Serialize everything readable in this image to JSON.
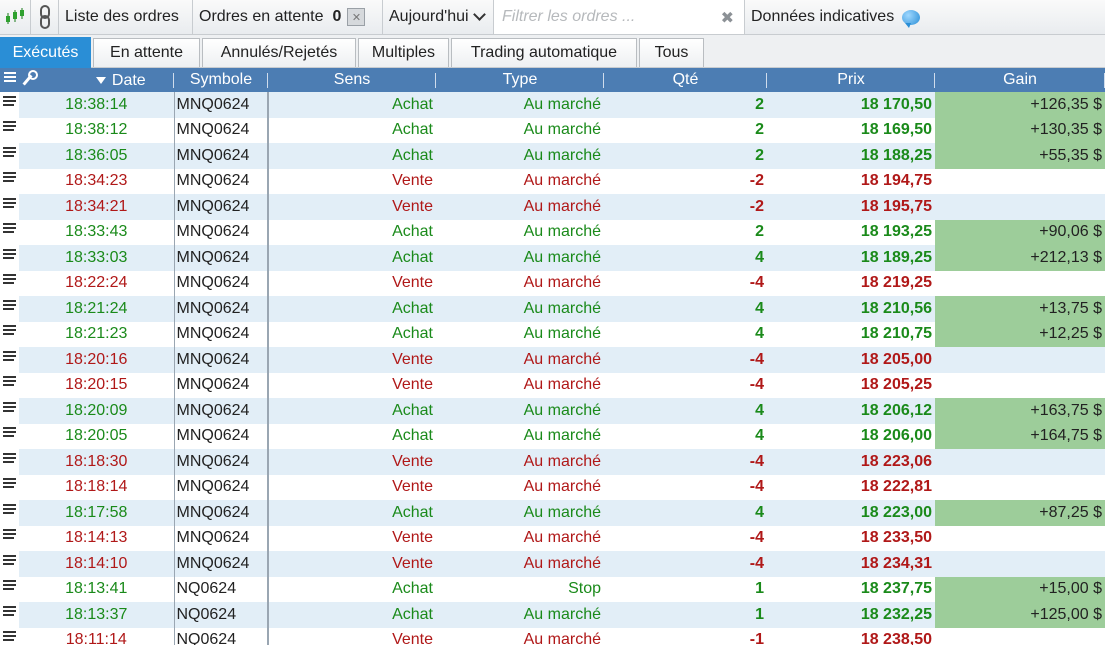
{
  "toolbar": {
    "orders_list_label": "Liste des ordres",
    "pending_label": "Ordres en attente",
    "pending_count": "0",
    "date_filter": "Aujourd'hui",
    "filter_placeholder": "Filtrer les ordres ...",
    "indicative_label": "Données indicatives",
    "icons": [
      "candlestick-chart-icon",
      "chain-link-icon",
      "clear-icon",
      "chevron-down-icon",
      "close-icon",
      "chat-bubble-icon"
    ]
  },
  "tabs": [
    "Exécutés",
    "En attente",
    "Annulés/Rejetés",
    "Multiples",
    "Trading automatique",
    "Tous"
  ],
  "active_tab": "Exécutés",
  "columns": [
    "Date",
    "Symbole",
    "Sens",
    "Type",
    "Qté",
    "Prix",
    "Gain"
  ],
  "colors": {
    "buy": "#1a8a1a",
    "sell": "#b01818",
    "header": "#4c7db3",
    "active_tab": "#2a8ed6",
    "gain_bg": "#9dcd9a",
    "row_alt": "#e2eef7"
  },
  "rows": [
    {
      "time": "18:38:14",
      "symbol": "MNQ0624",
      "side": "Achat",
      "type": "Au marché",
      "qty": "2",
      "price": "18 170,50",
      "gain": "+126,35 $"
    },
    {
      "time": "18:38:12",
      "symbol": "MNQ0624",
      "side": "Achat",
      "type": "Au marché",
      "qty": "2",
      "price": "18 169,50",
      "gain": "+130,35 $"
    },
    {
      "time": "18:36:05",
      "symbol": "MNQ0624",
      "side": "Achat",
      "type": "Au marché",
      "qty": "2",
      "price": "18 188,25",
      "gain": "+55,35 $"
    },
    {
      "time": "18:34:23",
      "symbol": "MNQ0624",
      "side": "Vente",
      "type": "Au marché",
      "qty": "-2",
      "price": "18 194,75",
      "gain": ""
    },
    {
      "time": "18:34:21",
      "symbol": "MNQ0624",
      "side": "Vente",
      "type": "Au marché",
      "qty": "-2",
      "price": "18 195,75",
      "gain": ""
    },
    {
      "time": "18:33:43",
      "symbol": "MNQ0624",
      "side": "Achat",
      "type": "Au marché",
      "qty": "2",
      "price": "18 193,25",
      "gain": "+90,06 $"
    },
    {
      "time": "18:33:03",
      "symbol": "MNQ0624",
      "side": "Achat",
      "type": "Au marché",
      "qty": "4",
      "price": "18 189,25",
      "gain": "+212,13 $"
    },
    {
      "time": "18:22:24",
      "symbol": "MNQ0624",
      "side": "Vente",
      "type": "Au marché",
      "qty": "-4",
      "price": "18 219,25",
      "gain": ""
    },
    {
      "time": "18:21:24",
      "symbol": "MNQ0624",
      "side": "Achat",
      "type": "Au marché",
      "qty": "4",
      "price": "18 210,56",
      "gain": "+13,75 $"
    },
    {
      "time": "18:21:23",
      "symbol": "MNQ0624",
      "side": "Achat",
      "type": "Au marché",
      "qty": "4",
      "price": "18 210,75",
      "gain": "+12,25 $"
    },
    {
      "time": "18:20:16",
      "symbol": "MNQ0624",
      "side": "Vente",
      "type": "Au marché",
      "qty": "-4",
      "price": "18 205,00",
      "gain": ""
    },
    {
      "time": "18:20:15",
      "symbol": "MNQ0624",
      "side": "Vente",
      "type": "Au marché",
      "qty": "-4",
      "price": "18 205,25",
      "gain": ""
    },
    {
      "time": "18:20:09",
      "symbol": "MNQ0624",
      "side": "Achat",
      "type": "Au marché",
      "qty": "4",
      "price": "18 206,12",
      "gain": "+163,75 $"
    },
    {
      "time": "18:20:05",
      "symbol": "MNQ0624",
      "side": "Achat",
      "type": "Au marché",
      "qty": "4",
      "price": "18 206,00",
      "gain": "+164,75 $"
    },
    {
      "time": "18:18:30",
      "symbol": "MNQ0624",
      "side": "Vente",
      "type": "Au marché",
      "qty": "-4",
      "price": "18 223,06",
      "gain": ""
    },
    {
      "time": "18:18:14",
      "symbol": "MNQ0624",
      "side": "Vente",
      "type": "Au marché",
      "qty": "-4",
      "price": "18 222,81",
      "gain": ""
    },
    {
      "time": "18:17:58",
      "symbol": "MNQ0624",
      "side": "Achat",
      "type": "Au marché",
      "qty": "4",
      "price": "18 223,00",
      "gain": "+87,25 $"
    },
    {
      "time": "18:14:13",
      "symbol": "MNQ0624",
      "side": "Vente",
      "type": "Au marché",
      "qty": "-4",
      "price": "18 233,50",
      "gain": ""
    },
    {
      "time": "18:14:10",
      "symbol": "MNQ0624",
      "side": "Vente",
      "type": "Au marché",
      "qty": "-4",
      "price": "18 234,31",
      "gain": ""
    },
    {
      "time": "18:13:41",
      "symbol": "NQ0624",
      "side": "Achat",
      "type": "Stop",
      "qty": "1",
      "price": "18 237,75",
      "gain": "+15,00 $"
    },
    {
      "time": "18:13:37",
      "symbol": "NQ0624",
      "side": "Achat",
      "type": "Au marché",
      "qty": "1",
      "price": "18 232,25",
      "gain": "+125,00 $"
    },
    {
      "time": "18:11:14",
      "symbol": "NQ0624",
      "side": "Vente",
      "type": "Au marché",
      "qty": "-1",
      "price": "18 238,50",
      "gain": ""
    }
  ]
}
